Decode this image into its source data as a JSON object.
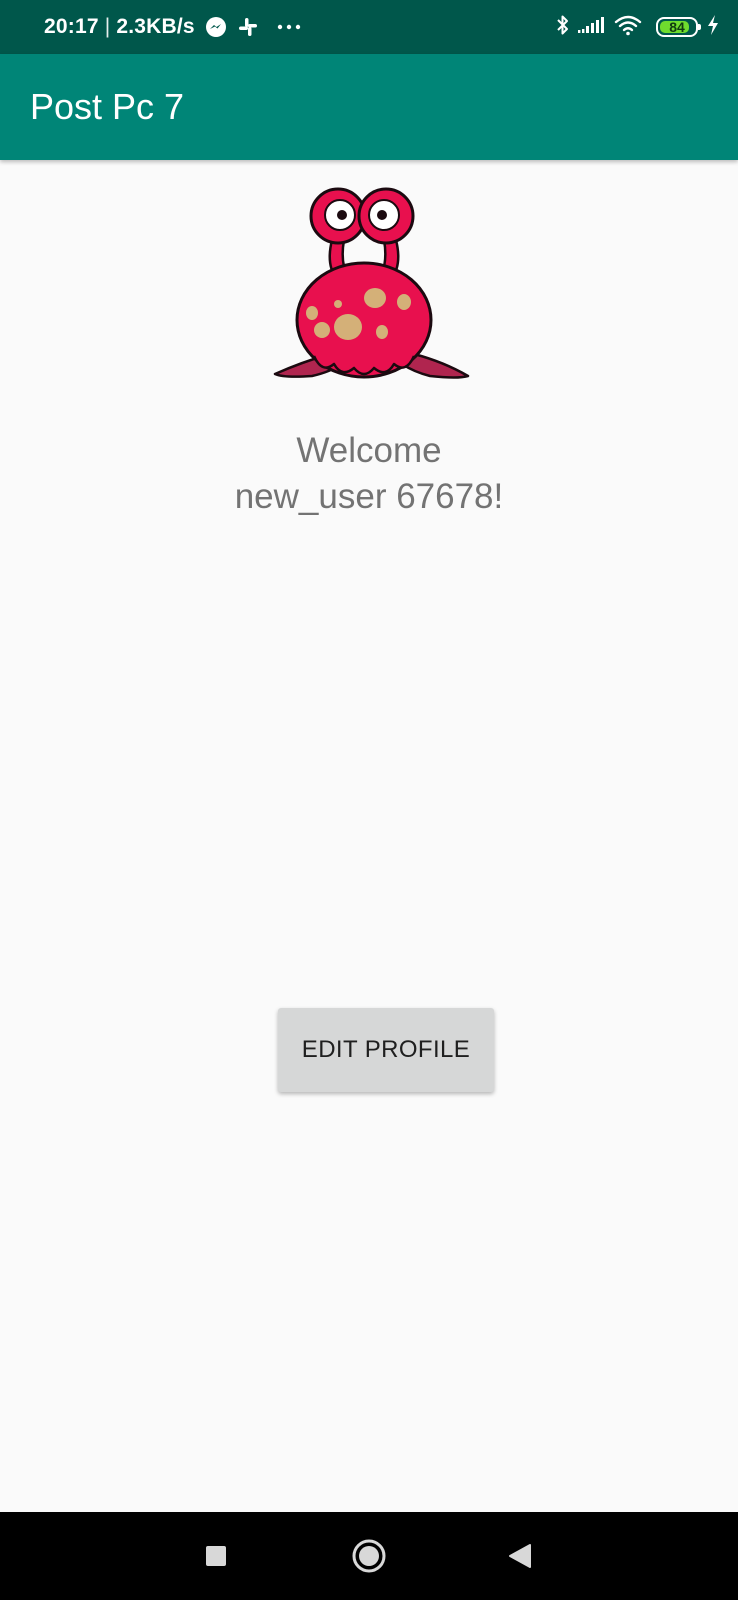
{
  "status_bar": {
    "time": "20:17",
    "separator": "|",
    "net_speed": "2.3KB/s",
    "left_icons": [
      "messenger-icon",
      "slack-icon",
      "more-notifications-icon"
    ],
    "right_icons": [
      "bluetooth-icon",
      "signal-icon",
      "wifi-icon",
      "battery-icon",
      "charging-icon"
    ],
    "battery_level": "84",
    "battery_fraction": 0.84
  },
  "app_bar": {
    "title": "Post Pc 7",
    "color": "#008577",
    "status_color": "#00574b"
  },
  "profile": {
    "avatar_icon": "pink-alien-monster-icon",
    "welcome_line1": "Welcome",
    "welcome_line2": "new_user 67678!"
  },
  "actions": {
    "edit_profile_label": "EDIT PROFILE"
  },
  "nav_bar": {
    "buttons": [
      "recents-square-icon",
      "home-circle-icon",
      "back-triangle-icon"
    ]
  }
}
